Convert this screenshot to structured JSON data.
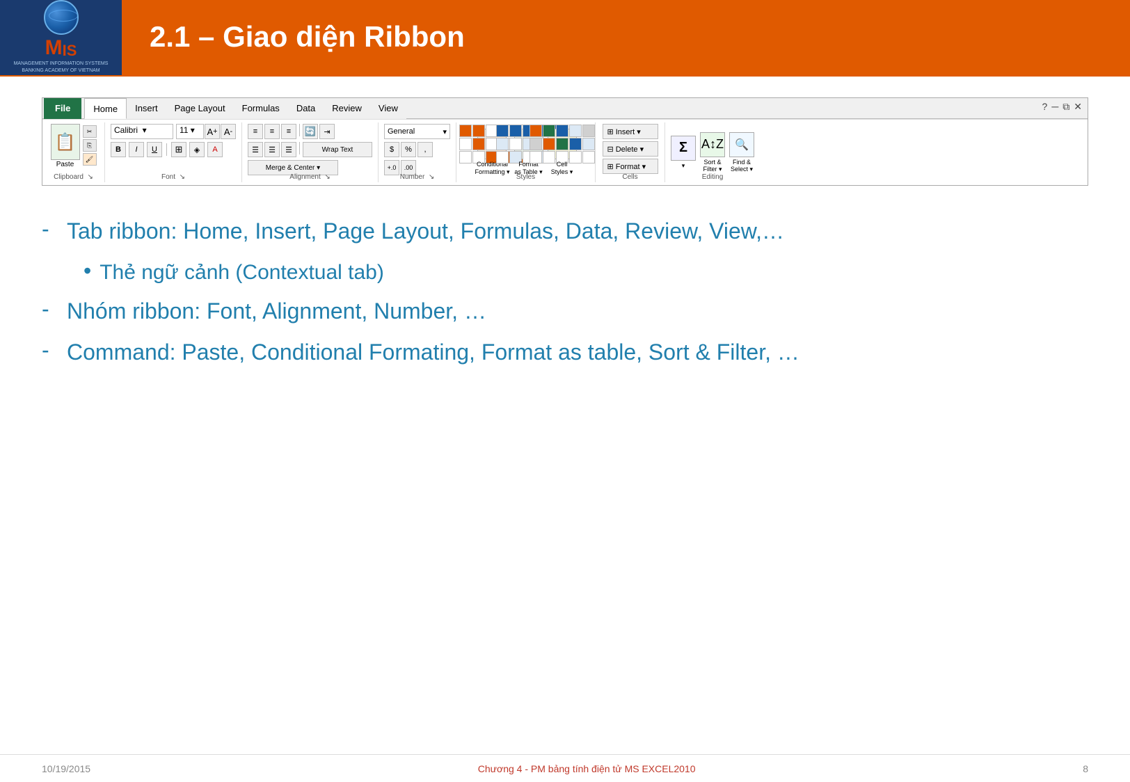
{
  "header": {
    "title": "2.1 – Giao diện Ribbon",
    "logo_text": "MIS",
    "logo_sub": "MANAGEMENT INFORMATION SYSTEMS\nBANKING ACADEMY OF VIETNAM"
  },
  "ribbon": {
    "tabs": [
      "File",
      "Home",
      "Insert",
      "Page Layout",
      "Formulas",
      "Data",
      "Review",
      "View"
    ],
    "active_tab": "Home",
    "groups": {
      "clipboard": {
        "label": "Clipboard"
      },
      "font": {
        "label": "Font",
        "font_name": "Calibri",
        "font_size": "11"
      },
      "alignment": {
        "label": "Alignment"
      },
      "number": {
        "label": "Number",
        "format": "General"
      },
      "styles": {
        "label": "Styles",
        "items": [
          "Conditional\nFormatting",
          "Format\nas Table",
          "Cell\nStyles"
        ]
      },
      "cells": {
        "label": "Cells",
        "buttons": [
          "Insert",
          "Delete",
          "Format"
        ]
      },
      "editing": {
        "label": "Editing",
        "items": [
          "Sum",
          "Sort &\nFilter",
          "Find &\nSelect"
        ]
      }
    }
  },
  "content": {
    "bullet1": {
      "text": "Tab ribbon: Home, Insert, Page Layout, Formulas, Data, Review, View,…"
    },
    "sub_bullet1": {
      "text": "Thẻ ngữ cảnh (Contextual tab)"
    },
    "bullet2": {
      "text": "Nhóm ribbon: Font, Alignment, Number, …"
    },
    "bullet3": {
      "text": "Command: Paste, Conditional Formating, Format as table, Sort & Filter, …"
    }
  },
  "footer": {
    "date": "10/19/2015",
    "center_text": "Chương 4 - PM bảng tính điện tử MS EXCEL2010",
    "page": "8"
  }
}
